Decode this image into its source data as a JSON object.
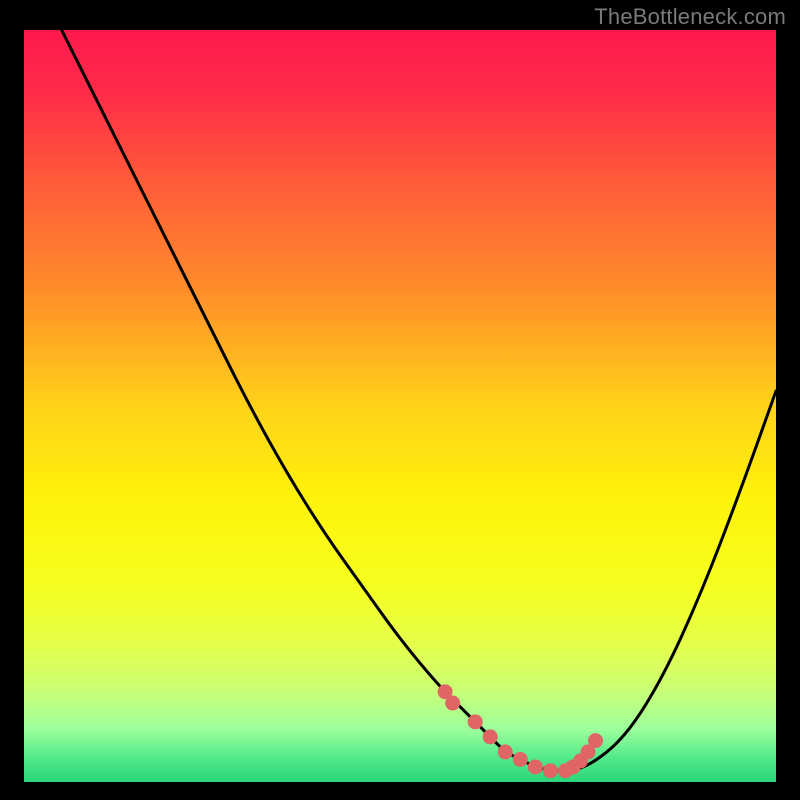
{
  "watermark": "TheBottleneck.com",
  "colors": {
    "page_bg": "#000000",
    "watermark": "#7a7a7a",
    "curve": "#000000",
    "marker": "#e06666",
    "gradient_stops": [
      {
        "offset": 0.0,
        "color": "#ff1a4d"
      },
      {
        "offset": 0.08,
        "color": "#ff2a4a"
      },
      {
        "offset": 0.2,
        "color": "#ff5a3a"
      },
      {
        "offset": 0.35,
        "color": "#ff8f2a"
      },
      {
        "offset": 0.5,
        "color": "#ffd21a"
      },
      {
        "offset": 0.62,
        "color": "#fff20a"
      },
      {
        "offset": 0.74,
        "color": "#f5ff20"
      },
      {
        "offset": 0.82,
        "color": "#e4ff4c"
      },
      {
        "offset": 0.88,
        "color": "#c8ff78"
      },
      {
        "offset": 0.93,
        "color": "#9cff9c"
      },
      {
        "offset": 0.97,
        "color": "#4fe88a"
      },
      {
        "offset": 1.0,
        "color": "#2bd47a"
      }
    ]
  },
  "chart_data": {
    "type": "line",
    "title": "",
    "xlabel": "",
    "ylabel": "",
    "xlim": [
      0,
      100
    ],
    "ylim": [
      0,
      100
    ],
    "grid": false,
    "legend": false,
    "series": [
      {
        "name": "bottleneck-curve",
        "x": [
          5,
          10,
          15,
          20,
          25,
          30,
          35,
          40,
          45,
          50,
          55,
          58,
          60,
          62,
          64,
          66,
          68,
          70,
          72,
          75,
          80,
          85,
          90,
          95,
          100
        ],
        "y": [
          100,
          90,
          80,
          70,
          60,
          50,
          41,
          33,
          26,
          19,
          13,
          10,
          8,
          6,
          4,
          3,
          2,
          1.5,
          1.5,
          2,
          6,
          14,
          25,
          38,
          52
        ]
      }
    ],
    "markers": {
      "name": "highlighted-points",
      "x": [
        56,
        57,
        60,
        62,
        64,
        66,
        68,
        70,
        72,
        73,
        74,
        75,
        76
      ],
      "y": [
        12,
        10.5,
        8,
        6,
        4,
        3,
        2,
        1.5,
        1.5,
        2,
        2.8,
        4,
        5.5
      ]
    }
  }
}
